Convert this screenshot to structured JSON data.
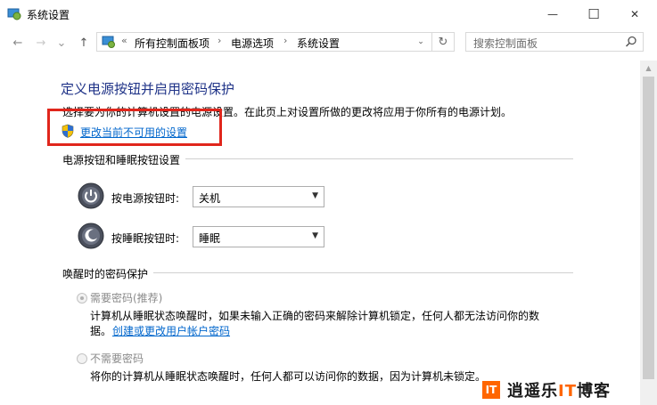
{
  "window": {
    "title": "系统设置",
    "minimize_glyph": "—",
    "maximize_glyph": "☐",
    "close_glyph": "✕"
  },
  "nav": {
    "back_glyph": "←",
    "forward_glyph": "→",
    "recent_glyph": "⌄",
    "up_glyph": "↑"
  },
  "address": {
    "overflow": "«",
    "crumbs": [
      "所有控制面板项",
      "电源选项",
      "系统设置"
    ],
    "separator": "›",
    "dropdown_glyph": "⌄",
    "refresh_glyph": "↻"
  },
  "search": {
    "placeholder": "搜索控制面板"
  },
  "main": {
    "heading": "定义电源按钮并启用密码保护",
    "description": "选择要为你的计算机设置的电源设置。在此页上对设置所做的更改将应用于你所有的电源计划。",
    "change_link": "更改当前不可用的设置",
    "buttons_section": {
      "title": "电源按钮和睡眠按钮设置",
      "rows": [
        {
          "label": "按电源按钮时:",
          "value": "关机"
        },
        {
          "label": "按睡眠按钮时:",
          "value": "睡眠"
        }
      ]
    },
    "wake_section": {
      "title": "唤醒时的密码保护",
      "require": {
        "label": "需要密码(推荐)",
        "desc_line1": "计算机从睡眠状态唤醒时，如果未输入正确的密码来解除计算机锁定，任何人都无法访问你的数",
        "desc_line2_prefix": "据。",
        "desc_link": "创建或更改用户帐户密码"
      },
      "no_require": {
        "label": "不需要密码",
        "desc": "将你的计算机从睡眠状态唤醒时，任何人都可以访问你的数据，因为计算机未锁定。"
      }
    }
  },
  "watermark": {
    "logo": "IT",
    "text_prefix": "逍遥乐",
    "text_it": "IT",
    "text_suffix": "博客"
  },
  "colors": {
    "heading": "#1e3287",
    "link": "#0066cc",
    "highlight_box": "#e0261c",
    "watermark_accent": "#ff6600"
  }
}
